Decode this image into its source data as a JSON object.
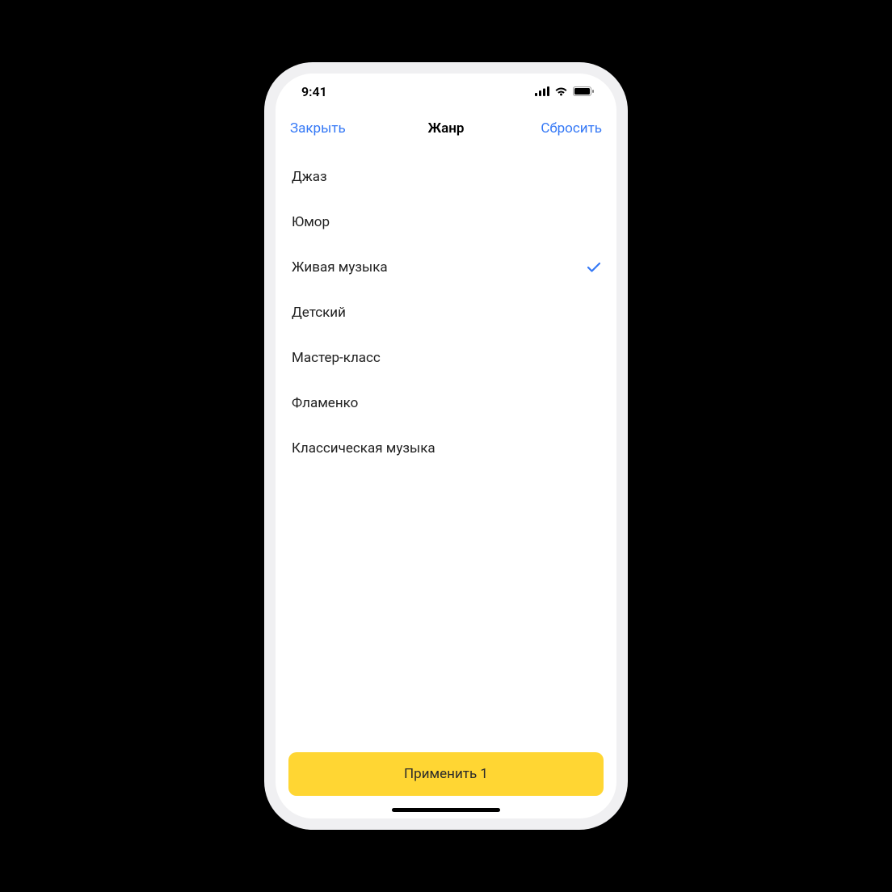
{
  "status": {
    "time": "9:41"
  },
  "nav": {
    "close": "Закрыть",
    "title": "Жанр",
    "reset": "Сбросить"
  },
  "genres": {
    "items": [
      {
        "label": "Джаз",
        "selected": false
      },
      {
        "label": "Юмор",
        "selected": false
      },
      {
        "label": "Живая музыка",
        "selected": true
      },
      {
        "label": "Детский",
        "selected": false
      },
      {
        "label": "Мастер-класс",
        "selected": false
      },
      {
        "label": "Фламенко",
        "selected": false
      },
      {
        "label": "Классическая музыка",
        "selected": false
      }
    ]
  },
  "footer": {
    "apply_label": "Применить 1"
  },
  "colors": {
    "accent": "#3478f6",
    "button_bg": "#ffd633"
  }
}
